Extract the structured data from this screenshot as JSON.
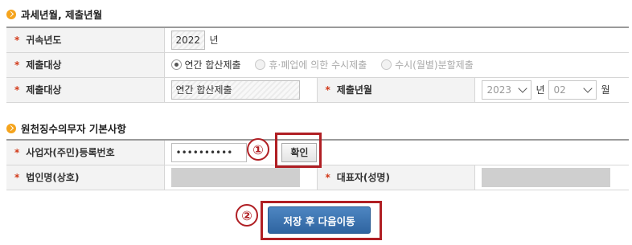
{
  "section1": {
    "title": "과세년월, 제출년월",
    "rows": {
      "year": {
        "label": "귀속년도",
        "value": "2022",
        "suffix": "년"
      },
      "submit_type": {
        "label": "제출대상",
        "options": [
          {
            "label": "연간 합산제출",
            "selected": true,
            "enabled": true
          },
          {
            "label": "휴·폐업에 의한 수시제출",
            "selected": false,
            "enabled": false
          },
          {
            "label": "수시(월별)분할제출",
            "selected": false,
            "enabled": false
          }
        ]
      },
      "submit_target": {
        "label": "제출대상",
        "value": "연간 합산제출"
      },
      "submit_month": {
        "label": "제출년월",
        "year": "2023",
        "year_suffix": "년",
        "month": "02",
        "month_suffix": "월"
      }
    }
  },
  "section2": {
    "title": "원천징수의무자 기본사항",
    "rows": {
      "biz_no": {
        "label": "사업자(주민)등록번호",
        "value": "••••••••••",
        "confirm_label": "확인"
      },
      "corp_name": {
        "label": "법인명(상호)",
        "value": ""
      },
      "rep_name": {
        "label": "대표자(성명)",
        "value": ""
      }
    }
  },
  "annotations": {
    "badge1": "①",
    "badge2": "②"
  },
  "actions": {
    "save_next": "저장 후 다음이동"
  },
  "colors": {
    "accent": "#b01f24",
    "primary": "#2f64a0",
    "bullet": "#f5a41d",
    "required": "#d23a1a"
  }
}
